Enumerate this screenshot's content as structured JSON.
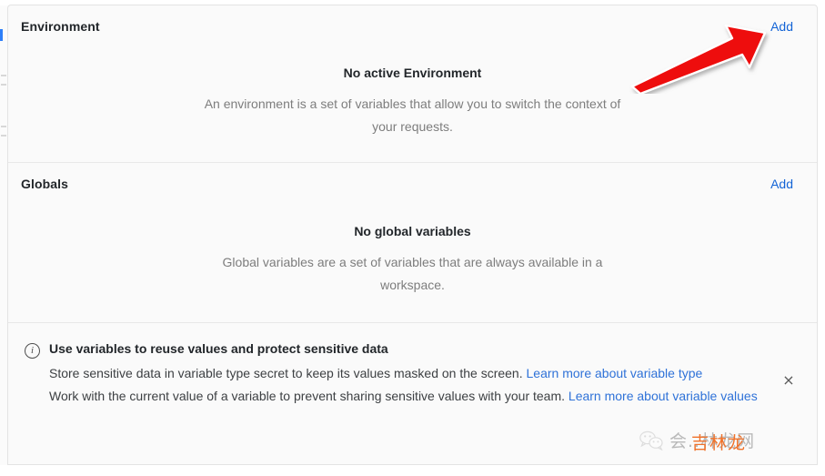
{
  "environment_section": {
    "title": "Environment",
    "add_label": "Add",
    "empty_title": "No active Environment",
    "empty_desc": "An environment is a set of variables that allow you to switch the context of your requests."
  },
  "globals_section": {
    "title": "Globals",
    "add_label": "Add",
    "empty_title": "No global variables",
    "empty_desc": "Global variables are a set of variables that are always available in a workspace."
  },
  "callout": {
    "icon": "info-circle-icon",
    "title": "Use variables to reuse values and protect sensitive data",
    "paragraph_1_text": "Store sensitive data in variable type secret to keep its values masked on the screen. ",
    "paragraph_1_link": "Learn more about variable type",
    "paragraph_2_text": "Work with the current value of a variable to prevent sharing sensitive values with your team. ",
    "paragraph_2_link": "Learn more about variable values",
    "close_label": "×"
  },
  "annotation": {
    "type": "arrow",
    "color": "#ee1111",
    "points_to": "Add"
  },
  "watermark": {
    "logo": "wechat-icon",
    "text": "会..林龙网",
    "overlay_text": "吉林龙",
    "color": "#b9b9b9",
    "overlay_color": "#f0722a"
  },
  "colors": {
    "link": "#1364d6",
    "panel_bg": "#fafafa",
    "divider": "#e8e8e8",
    "title": "#22262a",
    "muted": "#7d7d7d"
  }
}
